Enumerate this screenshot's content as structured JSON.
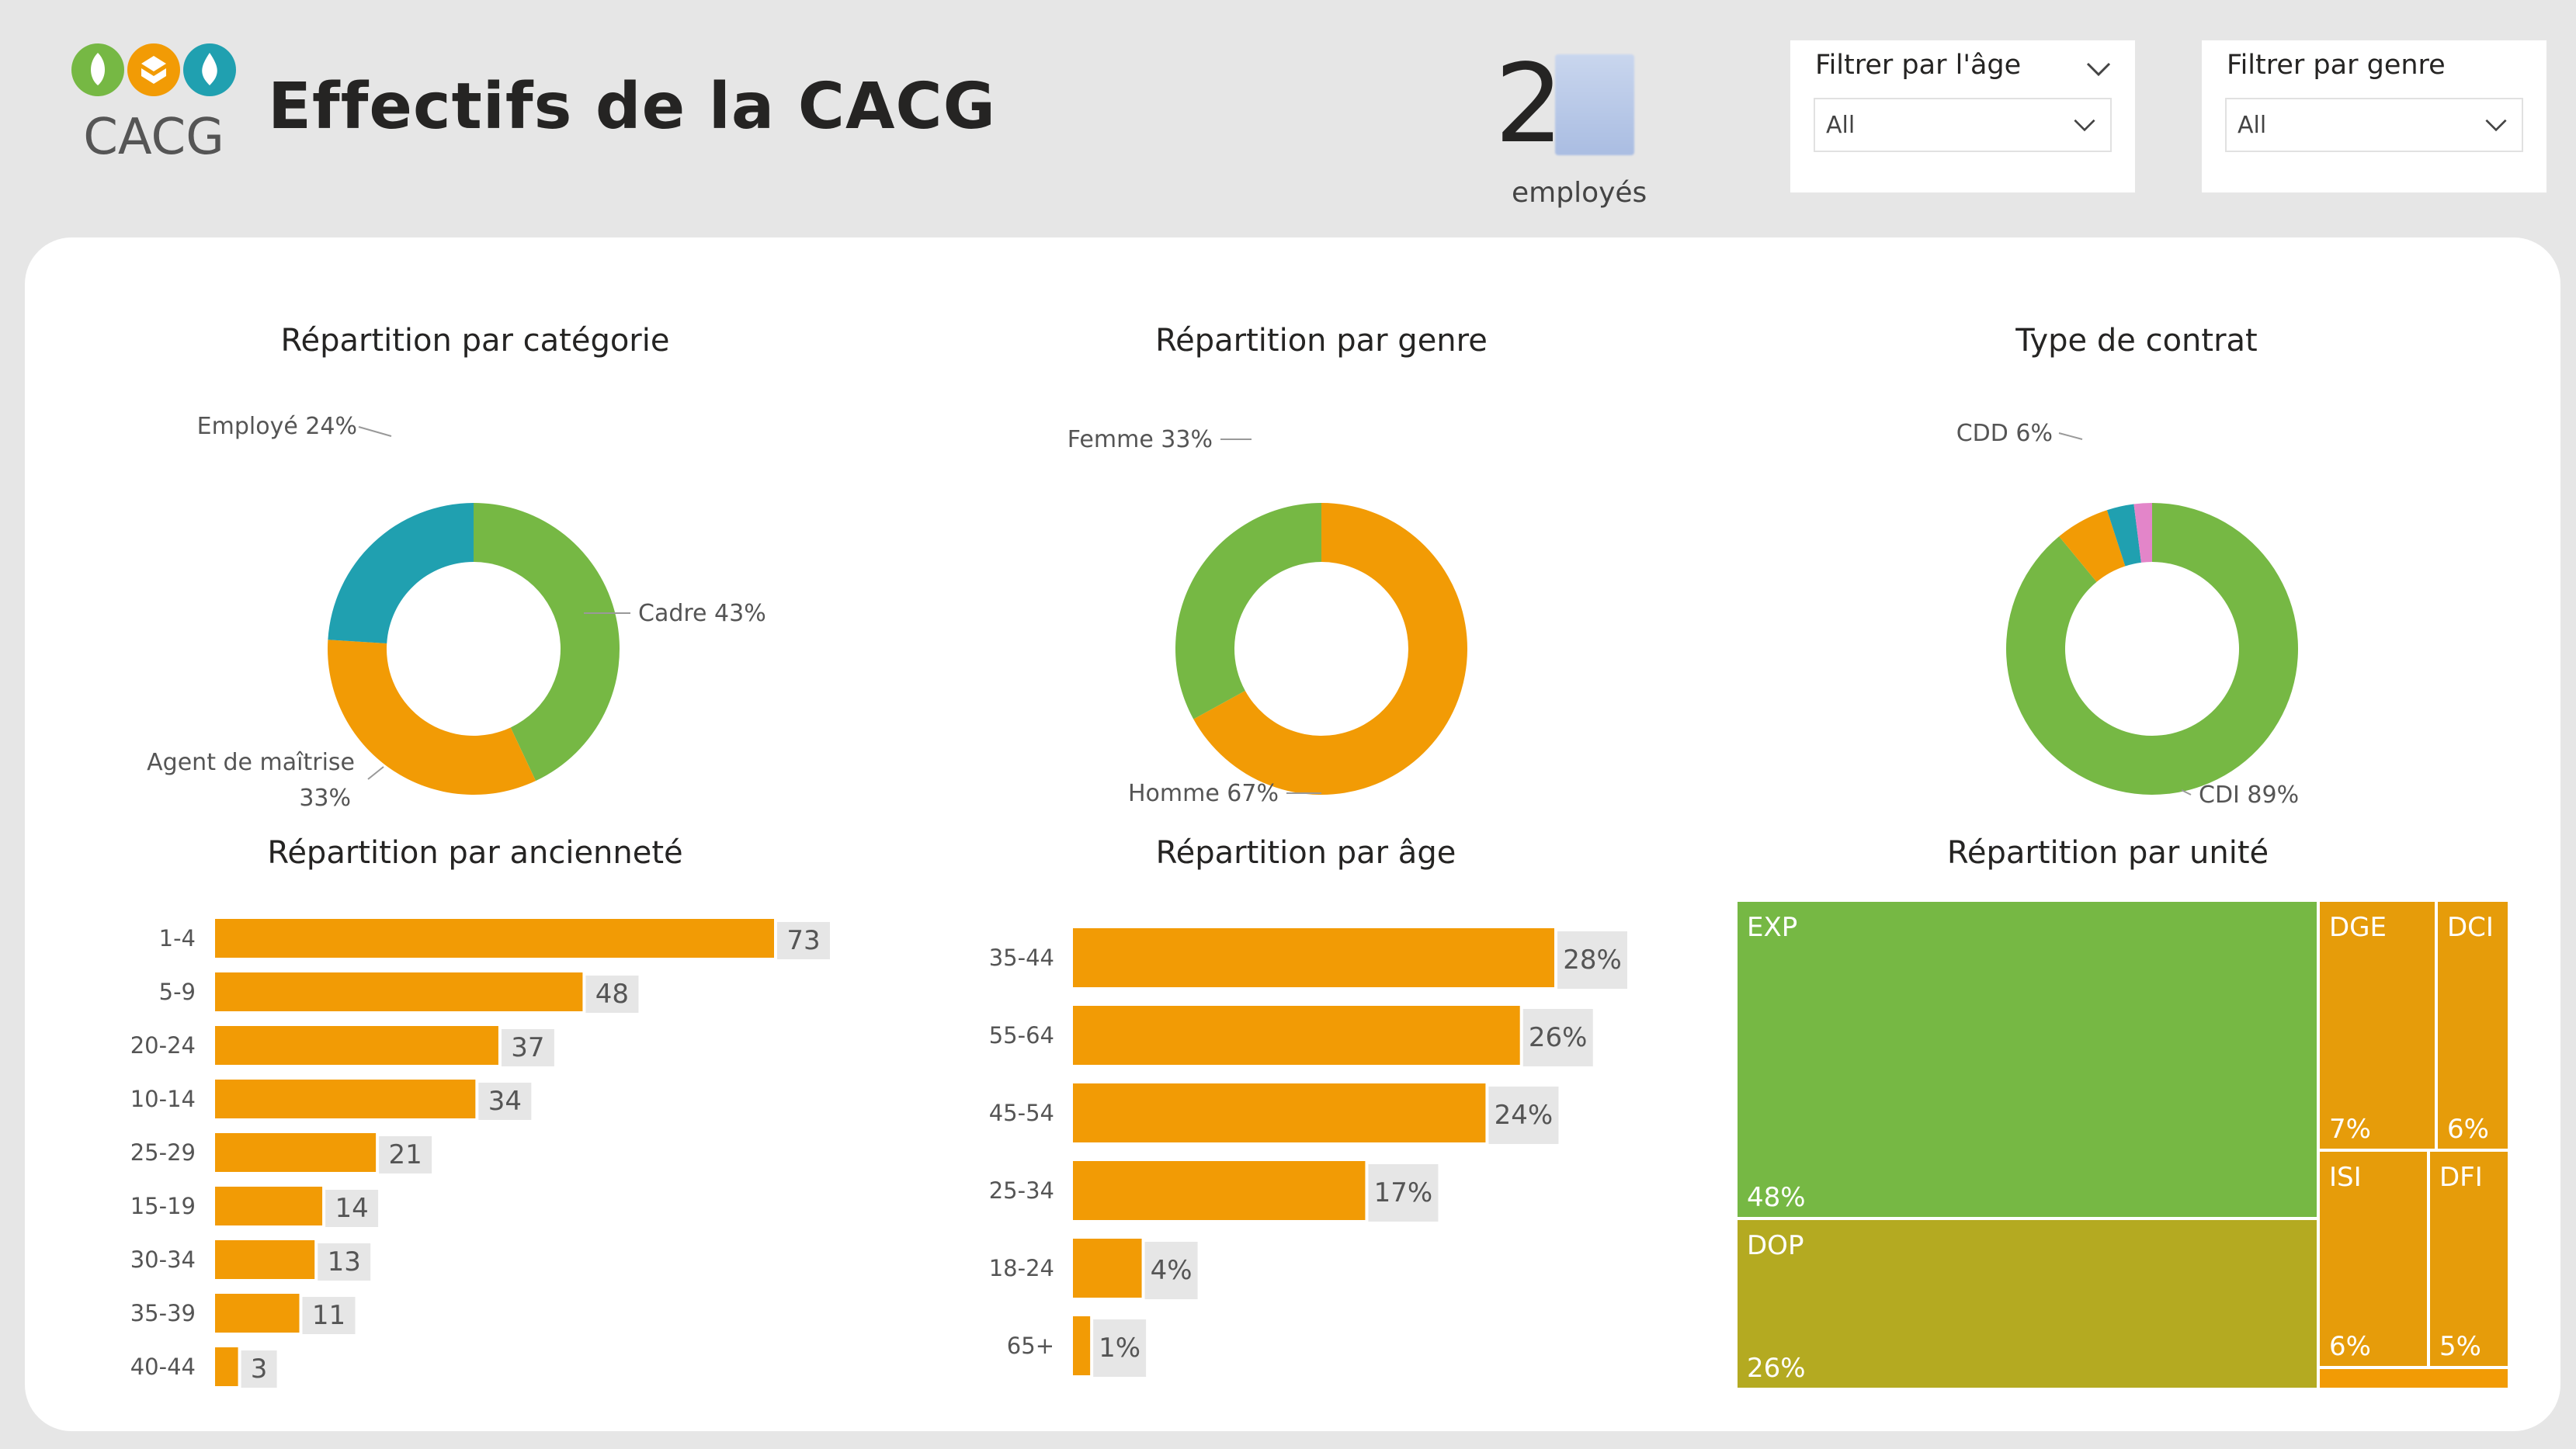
{
  "header": {
    "title": "Effectifs de la CACG",
    "logo_text": "CACG",
    "kpi": {
      "value_visible": "2",
      "label": "employés"
    }
  },
  "filters": [
    {
      "title": "Filtrer par l'âge",
      "selected": "All"
    },
    {
      "title": "Filtrer par genre",
      "selected": "All"
    }
  ],
  "colors": {
    "green": "#76b844",
    "orange": "#f29b05",
    "teal": "#20a0b0",
    "pink": "#e385c9",
    "olive": "#b4aa21",
    "darkorange": "#e69c0a",
    "label_bg": "#e6e6e6"
  },
  "chart_data": [
    {
      "type": "pie",
      "title": "Répartition par catégorie",
      "slices": [
        {
          "label": "Cadre",
          "value": 43,
          "label_text": "Cadre 43%",
          "color": "#76b844"
        },
        {
          "label": "Agent de maîtrise",
          "value": 33,
          "label_text": "Agent de maîtrise",
          "label_text2": "33%",
          "color": "#f29b05"
        },
        {
          "label": "Employé",
          "value": 24,
          "label_text": "Employé 24%",
          "color": "#20a0b0"
        }
      ]
    },
    {
      "type": "pie",
      "title": "Répartition par genre",
      "slices": [
        {
          "label": "Homme",
          "value": 67,
          "label_text": "Homme 67%",
          "color": "#f29b05"
        },
        {
          "label": "Femme",
          "value": 33,
          "label_text": "Femme 33%",
          "color": "#76b844"
        }
      ]
    },
    {
      "type": "pie",
      "title": "Type de contrat",
      "slices": [
        {
          "label": "CDI",
          "value": 89,
          "label_text": "CDI 89%",
          "color": "#76b844"
        },
        {
          "label": "CDD",
          "value": 6,
          "label_text": "CDD 6%",
          "color": "#f29b05"
        },
        {
          "label": "",
          "value": 3,
          "label_text": "",
          "color": "#20a0b0"
        },
        {
          "label": "",
          "value": 2,
          "label_text": "",
          "color": "#e385c9"
        }
      ]
    },
    {
      "type": "bar",
      "title": "Répartition par ancienneté",
      "categories": [
        "1-4",
        "5-9",
        "20-24",
        "10-14",
        "25-29",
        "15-19",
        "30-34",
        "35-39",
        "40-44"
      ],
      "values": [
        73,
        48,
        37,
        34,
        21,
        14,
        13,
        11,
        3
      ],
      "value_labels": [
        "73",
        "48",
        "37",
        "34",
        "21",
        "14",
        "13",
        "11",
        "3"
      ],
      "xlim": [
        0,
        73
      ],
      "color": "#f29b05"
    },
    {
      "type": "bar",
      "title": "Répartition par âge",
      "categories": [
        "35-44",
        "55-64",
        "45-54",
        "25-34",
        "18-24",
        "65+"
      ],
      "values": [
        28,
        26,
        24,
        17,
        4,
        1
      ],
      "value_labels": [
        "28%",
        "26%",
        "24%",
        "17%",
        "4%",
        "1%"
      ],
      "xlim": [
        0,
        28
      ],
      "color": "#f29b05"
    },
    {
      "type": "treemap",
      "title": "Répartition par unité",
      "items": [
        {
          "label": "EXP",
          "value": 48,
          "value_text": "48%",
          "color": "#76b844"
        },
        {
          "label": "DOP",
          "value": 26,
          "value_text": "26%",
          "color": "#b4aa21"
        },
        {
          "label": "DGE",
          "value": 7,
          "value_text": "7%",
          "color": "#e69c0a"
        },
        {
          "label": "DCI",
          "value": 6,
          "value_text": "6%",
          "color": "#e69c0a"
        },
        {
          "label": "ISI",
          "value": 6,
          "value_text": "6%",
          "color": "#e69c0a"
        },
        {
          "label": "DFI",
          "value": 5,
          "value_text": "5%",
          "color": "#e69c0a"
        },
        {
          "label": "",
          "value": 2,
          "value_text": "",
          "color": "#f29b05"
        }
      ]
    }
  ]
}
